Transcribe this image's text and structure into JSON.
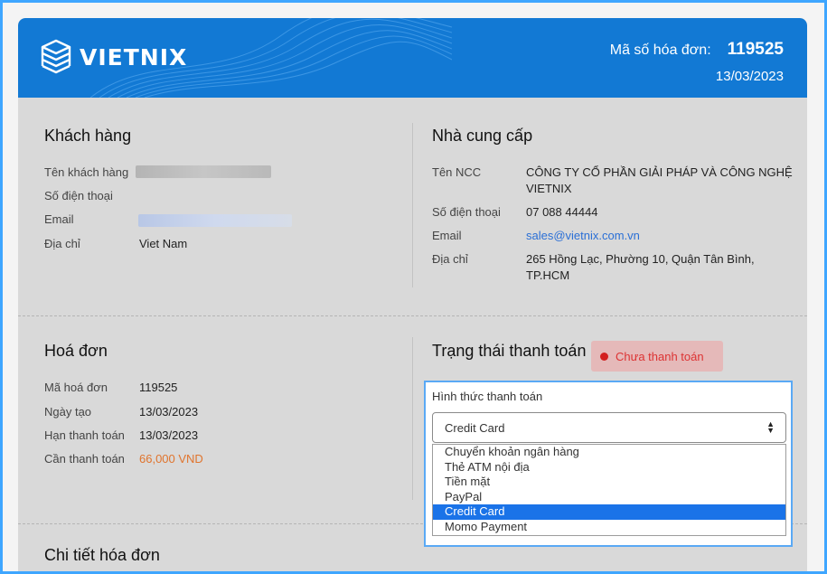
{
  "header": {
    "brand": "VIETNIX",
    "invoice_label": "Mã số hóa đơn:",
    "invoice_number": "119525",
    "invoice_date": "13/03/2023",
    "brand_color": "#1279d4"
  },
  "customer": {
    "title": "Khách hàng",
    "name_label": "Tên khách hàng",
    "phone_label": "Số điện thoại",
    "email_label": "Email",
    "address_label": "Địa chỉ",
    "address_value": "Viet Nam"
  },
  "supplier": {
    "title": "Nhà cung cấp",
    "name_label": "Tên NCC",
    "name_value_line1": "CÔNG TY CỔ PHẦN GIẢI PHÁP VÀ CÔNG NGHỆ",
    "name_value_line2": "VIETNIX",
    "phone_label": "Số điện thoại",
    "phone_value": "07 088 44444",
    "email_label": "Email",
    "email_value": "sales@vietnix.com.vn",
    "address_label": "Địa chỉ",
    "address_line1": "265 Hồng Lạc, Phường 10, Quận Tân Bình,",
    "address_line2": "TP.HCM"
  },
  "invoice": {
    "title": "Hoá đơn",
    "code_label": "Mã hoá đơn",
    "code_value": "119525",
    "created_label": "Ngày tạo",
    "created_value": "13/03/2023",
    "due_label": "Hạn thanh toán",
    "due_value": "13/03/2023",
    "amount_label": "Cần thanh toán",
    "amount_value": "66,000 VND"
  },
  "payment": {
    "title": "Trạng thái thanh toán",
    "status": "Chưa thanh toán",
    "method_label": "Hình thức thanh toán",
    "selected": "Credit Card",
    "options": [
      "Chuyển khoản ngân hàng",
      "Thẻ ATM nội địa",
      "Tiền mặt",
      "PayPal",
      "Credit Card",
      "Momo Payment"
    ]
  },
  "details": {
    "title": "Chi tiết hóa đơn"
  }
}
